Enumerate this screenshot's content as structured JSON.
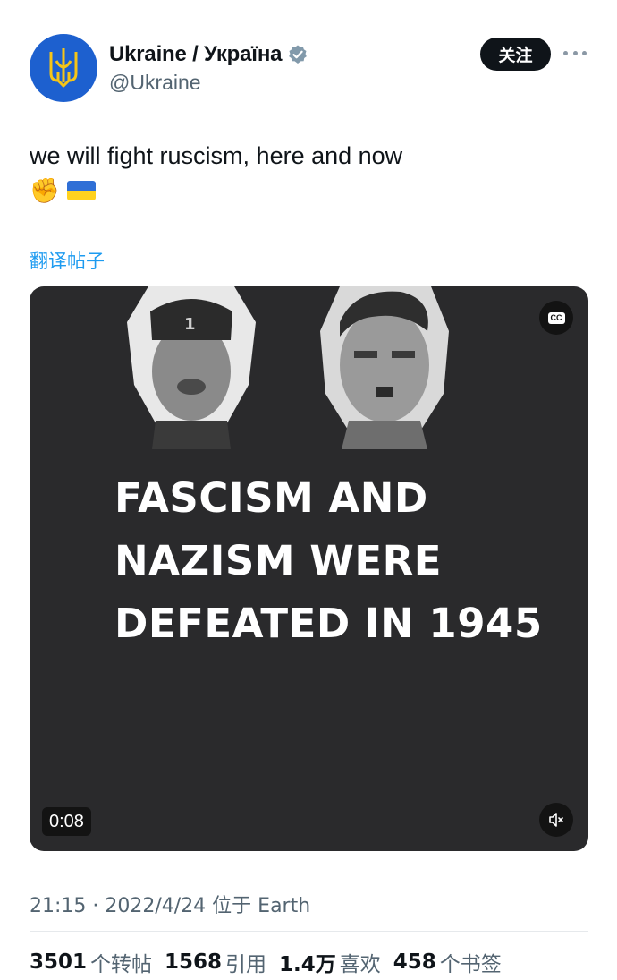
{
  "author": {
    "display_name": "Ukraine / Україна",
    "handle": "@Ukraine"
  },
  "actions": {
    "follow_label": "关注"
  },
  "tweet": {
    "text": "we will fight ruscism, here and now",
    "emojis": [
      "✊"
    ],
    "translate_label": "翻译帖子"
  },
  "media": {
    "overlay_text": "FASCISM AND\nNAZISM WERE\nDEFEATED IN 1945",
    "duration": "0:08",
    "cc_label": "CC"
  },
  "meta": {
    "timestamp": "21:15 · 2022/4/24 位于 Earth"
  },
  "stats": [
    {
      "value": "3501",
      "label": "个转帖"
    },
    {
      "value": "1568",
      "label": "引用"
    },
    {
      "value": "1.4万",
      "label": "喜欢"
    },
    {
      "value": "458",
      "label": "个书签"
    }
  ],
  "colors": {
    "accent": "#1d9bf0",
    "avatar_bg": "#1d60cf",
    "flag_blue": "#2f6fd6",
    "flag_yellow": "#ffd21e",
    "media_bg": "#2a2a2c"
  },
  "icons": [
    "trident-icon",
    "verified-badge-icon",
    "more-icon",
    "cc-icon",
    "mute-icon",
    "fist-emoji",
    "ukraine-flag-emoji"
  ]
}
